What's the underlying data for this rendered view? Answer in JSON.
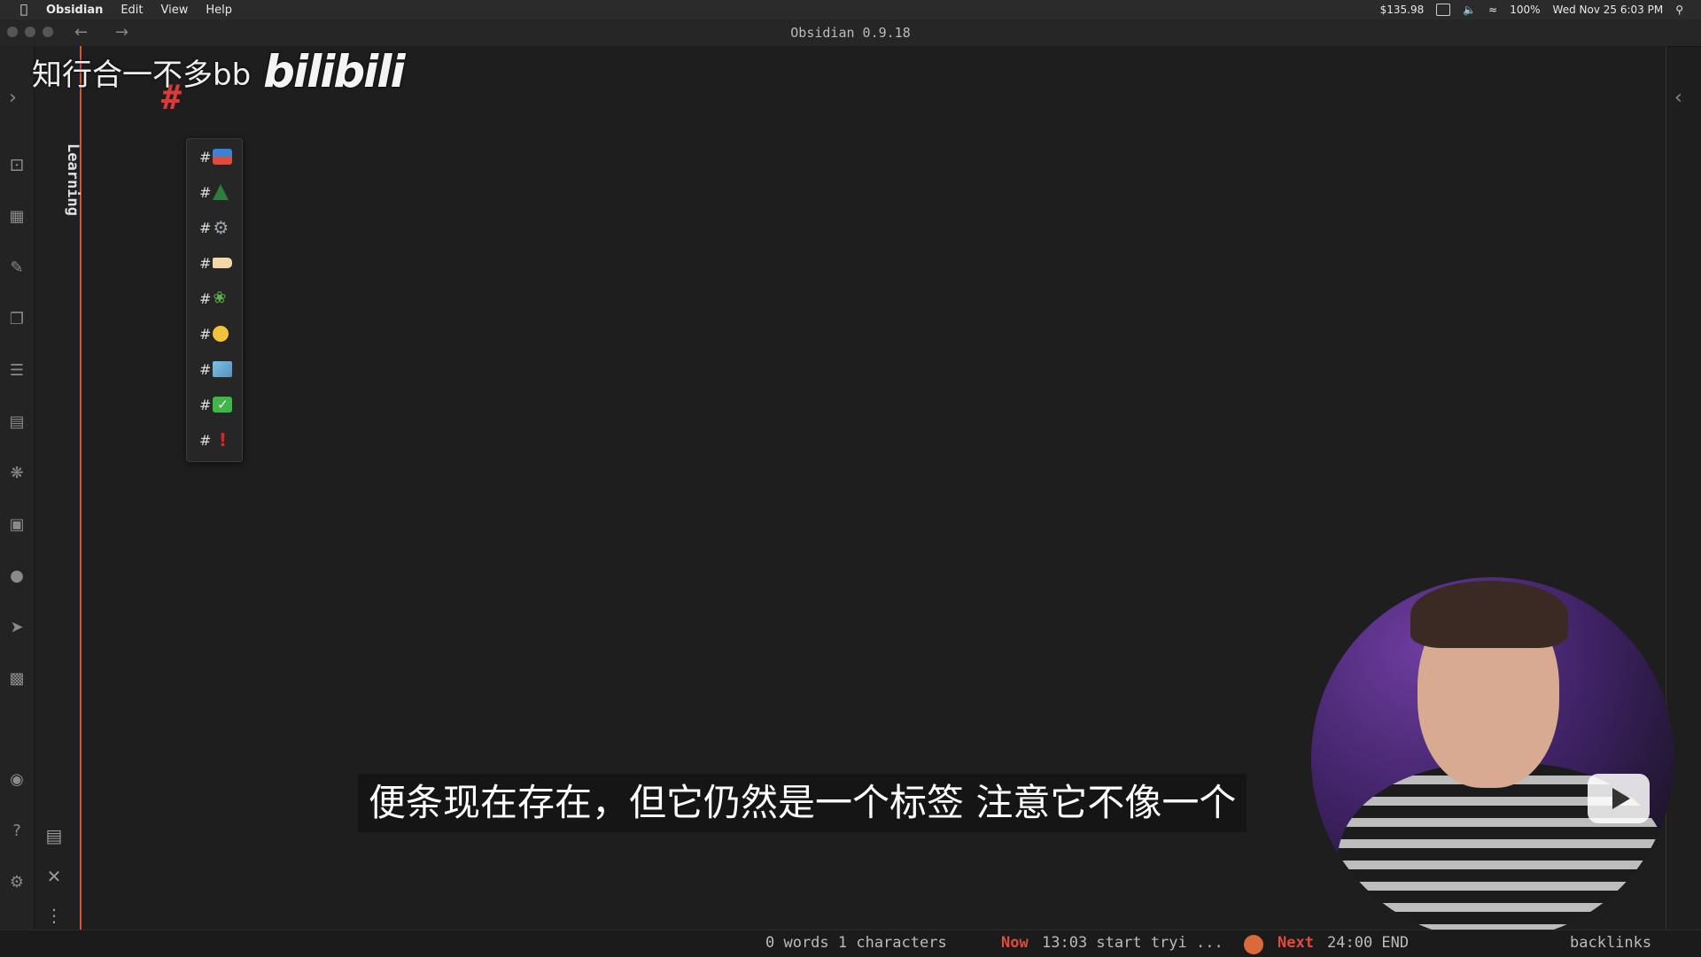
{
  "menubar": {
    "app": "Obsidian",
    "items": [
      "Edit",
      "View",
      "Help"
    ],
    "price": "$135.98",
    "battery": "100%",
    "datetime": "Wed Nov 25 6:03 PM"
  },
  "window": {
    "title": "Obsidian 0.9.18"
  },
  "sidebar": {
    "vertical_label": "Learning"
  },
  "editor": {
    "cursor_text": "#"
  },
  "suggestions": [
    {
      "prefix": "#",
      "icon": "inbox-emoji"
    },
    {
      "prefix": "#",
      "icon": "evergreen-tree-emoji"
    },
    {
      "prefix": "#",
      "icon": "gear-emoji"
    },
    {
      "prefix": "#",
      "icon": "label-emoji"
    },
    {
      "prefix": "#",
      "icon": "seedling-emoji"
    },
    {
      "prefix": "#",
      "icon": "neutral-face-emoji"
    },
    {
      "prefix": "#",
      "icon": "map-emoji"
    },
    {
      "prefix": "#",
      "icon": "check-mark-emoji"
    },
    {
      "prefix": "#",
      "icon": "exclamation-emoji"
    }
  ],
  "overlay": {
    "watermark_text": "知行合一不多bb",
    "watermark_logo": "bilibili",
    "subtitle": "便条现在存在，但它仍然是一个标签 注意它不像一个"
  },
  "statusbar": {
    "word_count": "0 words 1 characters",
    "now_label": "Now",
    "now_value": "13:03 start tryi ...",
    "next_label": "Next",
    "next_value": "24:00 END",
    "backlinks": "backlinks"
  },
  "colors": {
    "accent": "#d93a3a",
    "sidebar_border": "#d2563a",
    "background": "#1e1e1e"
  }
}
